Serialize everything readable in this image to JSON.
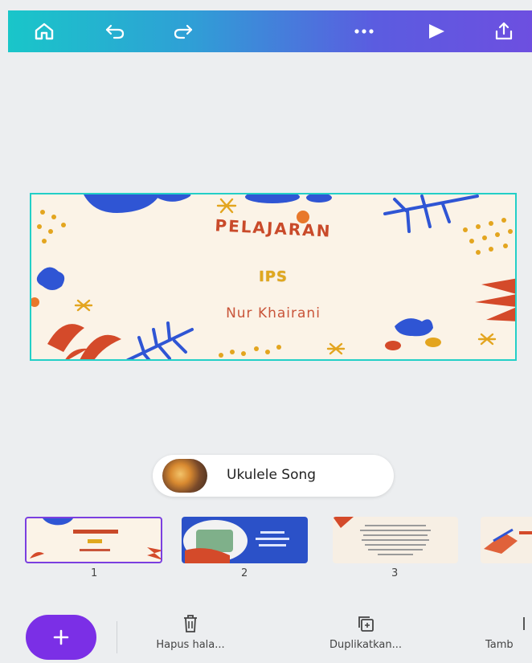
{
  "toolbar": {
    "icons": [
      "home-icon",
      "undo-icon",
      "redo-icon",
      "more-icon",
      "play-icon",
      "share-icon"
    ]
  },
  "design": {
    "title": "PELAJARAN",
    "subtitle": "IPS",
    "author": "Nur Khairani"
  },
  "music": {
    "label": "Ukulele Song"
  },
  "pages": [
    {
      "number": "1"
    },
    {
      "number": "2"
    },
    {
      "number": "3"
    }
  ],
  "bottom_actions": {
    "delete_label": "Hapus hala...",
    "duplicate_label": "Duplikatkan...",
    "add_label": "Tamb"
  },
  "colors": {
    "accent": "#7b2fe6",
    "selection": "#23cfc7"
  }
}
